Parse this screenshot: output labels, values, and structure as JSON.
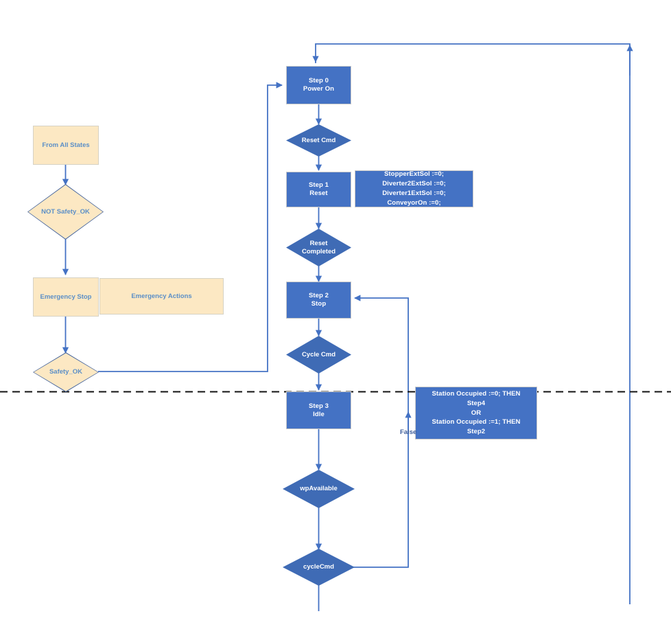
{
  "diagram": {
    "title": "Conveyor station state machine flowchart",
    "colors": {
      "process_fill": "#4472C4",
      "decision_fill": "#3F6BB5",
      "safety_fill": "#FCE8C3",
      "safety_text": "#5B8FC7",
      "connector": "#4472C4",
      "divider": "#000000"
    },
    "safety_branch": {
      "from_all_states": "From All States",
      "not_safety_ok": "NOT Safety_OK",
      "emergency_stop": "Emergency Stop",
      "emergency_actions": "Emergency Actions",
      "safety_ok": "Safety_OK"
    },
    "main_branch": {
      "step0": "Step 0\nPower On",
      "reset_cmd": "Reset Cmd",
      "step1": "Step 1\nReset",
      "step1_actions": "StopperExtSol :=0;\nDiverter2ExtSol :=0;\nDiverter1ExtSol :=0;\nConveyorOn :=0;",
      "reset_completed": "Reset\nCompleted",
      "step2": "Step 2\nStop",
      "cycle_cmd": "Cycle Cmd",
      "step3": "Step 3\nIdle",
      "step3_actions": "Station Occupied :=0; THEN\nStep4\nOR\nStation Occupied :=1; THEN\nStep2",
      "wp_available": "wpAvailable",
      "cycle_cmd_lower": "cycleCmd"
    },
    "edge_labels": {
      "false": "False"
    }
  }
}
